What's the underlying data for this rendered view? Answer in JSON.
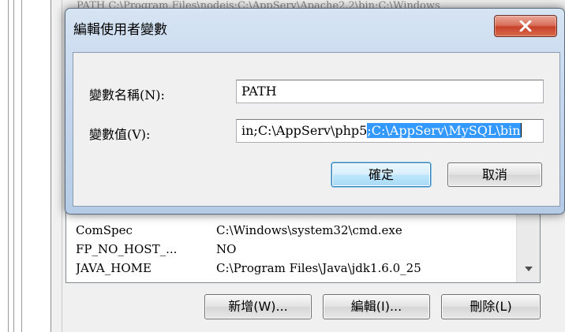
{
  "background": {
    "top_ghost_text": "PATH  C:\\Program Files\\nodejs;C:\\AppServ\\Apache2.2\\bin;C:\\Windows",
    "env_list": [
      {
        "name": "ComSpec",
        "value": "C:\\Windows\\system32\\cmd.exe"
      },
      {
        "name": "FP_NO_HOST_...",
        "value": "NO"
      },
      {
        "name": "JAVA_HOME",
        "value": "C:\\Program Files\\Java\\jdk1.6.0_25"
      }
    ],
    "buttons": {
      "new": "新增(W)...",
      "edit": "編輯(I)...",
      "delete": "刪除(L)"
    }
  },
  "dialog": {
    "title": "編輯使用者變數",
    "name_label": "變數名稱(N):",
    "name_value": "PATH",
    "value_label": "變數值(V):",
    "value_unselected": "in;C:\\AppServ\\php5",
    "value_selected": ";C:\\AppServ\\MySQL\\bin",
    "ok_label": "確定",
    "cancel_label": "取消"
  },
  "icons": {
    "close": "close-icon",
    "scroll_down": "chevron-down-icon"
  }
}
